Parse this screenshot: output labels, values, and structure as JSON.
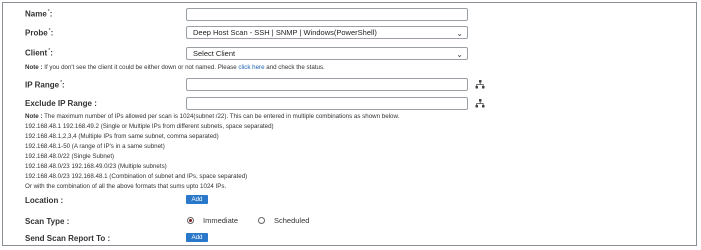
{
  "form": {
    "name": {
      "label": "Name",
      "value": ""
    },
    "probe": {
      "label": "Probe",
      "selected": "Deep Host Scan - SSH | SNMP | Windows(PowerShell)"
    },
    "client": {
      "label": "Client",
      "selected": "Select Client"
    },
    "client_note": {
      "prefix": "Note :",
      "text": " If you don't see the client it could be either down or not named. Please ",
      "link": "click here",
      "suffix": " and check the status."
    },
    "ip_range": {
      "label": "IP Range",
      "value": ""
    },
    "exclude_ip_range": {
      "label": "Exclude IP Range :",
      "value": ""
    },
    "ip_note": {
      "prefix": "Note :",
      "text": " The maximum number of IPs allowed per scan is 1024(subnet /22). This can be entered in multiple combinations as shown below.",
      "examples": [
        "192.168.48.1 192.168.49.2 (Single or Multiple IPs from different subnets, space separated)",
        "192.168.48.1,2,3,4 (Multiple IPs from same subnet, comma separated)",
        "192.168.48.1-50 (A range of IP's in a same subnet)",
        "192.168.48.0/22 (Single Subnet)",
        "192.168.48.0/23 192.168.49.0/23 (Multiple subnets)",
        "192.168.48.0/23 192.168.48.1 (Combination of subnet and IPs, space separated)",
        "Or with the combination of all the above formats that sums upto 1024 IPs."
      ]
    },
    "location": {
      "label": "Location :",
      "button": "Add"
    },
    "scan_type": {
      "label": "Scan Type :",
      "options": [
        {
          "label": "Immediate",
          "selected": true
        },
        {
          "label": "Scheduled",
          "selected": false
        }
      ]
    },
    "send_report": {
      "label": "Send Scan Report To :",
      "button": "Add"
    }
  },
  "required_marker": "*",
  "colors": {
    "button": "#2a78c9",
    "link": "#1a5fb4",
    "radio_selected": "#7a1f1f"
  }
}
